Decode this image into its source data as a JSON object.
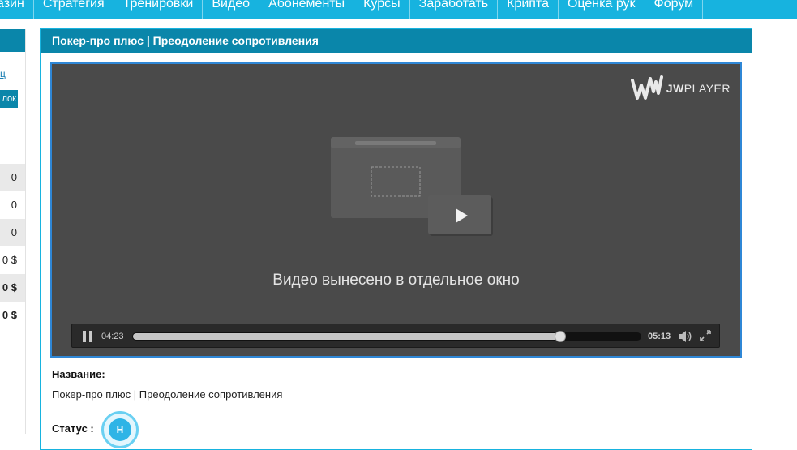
{
  "nav": {
    "items": [
      {
        "label": "азин"
      },
      {
        "label": "Стратегия"
      },
      {
        "label": "Тренировки"
      },
      {
        "label": "Видео"
      },
      {
        "label": "Абонементы"
      },
      {
        "label": "Курсы"
      },
      {
        "label": "Заработать"
      },
      {
        "label": "Крипта"
      },
      {
        "label": "Оценка рук"
      },
      {
        "label": "Форум"
      }
    ]
  },
  "sidebar": {
    "link_label": "ц",
    "button_label": "лок",
    "stats": [
      "0",
      "0",
      "0",
      "0 $",
      "0 $",
      "0 $"
    ]
  },
  "panel": {
    "title": "Покер-про плюс | Преодоление сопротивления"
  },
  "player": {
    "brand": {
      "part1": "JW",
      "part2": "PLAYER"
    },
    "message": "Видео вынесено в отдельное окно",
    "time_elapsed": "04:23",
    "time_total": "05:13",
    "progress": 0.84
  },
  "meta": {
    "name_label": "Название:",
    "name_value": "Покер-про плюс | Преодоление сопротивления",
    "status_label": "Статус :",
    "status_badge": "Н"
  },
  "icons": {
    "pause": "pause-icon",
    "volume": "volume-icon",
    "fullscreen": "fullscreen-icon",
    "popout": "popout-window-icon",
    "logo": "jwplayer-logo-icon"
  },
  "colors": {
    "nav_bg": "#17b3df",
    "header_bg": "#0a86aa",
    "player_bg": "#4a4a4a",
    "player_border": "#2f87d6"
  }
}
